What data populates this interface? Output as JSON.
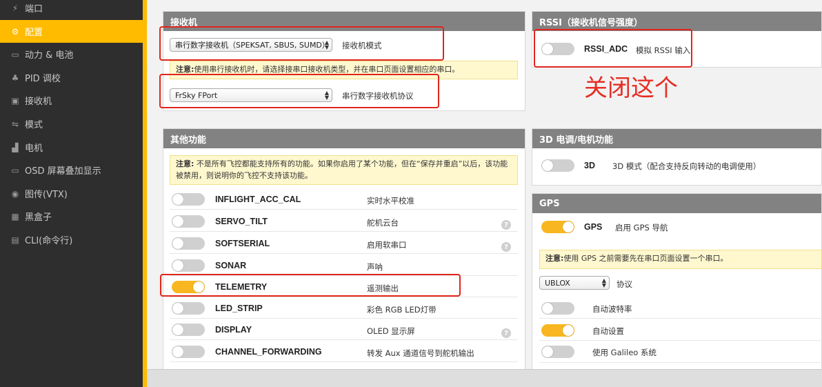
{
  "sidebar": {
    "items": [
      {
        "label": "端口",
        "icon": "plug-icon",
        "glyph": "⚡"
      },
      {
        "label": "配置",
        "icon": "gear-icon",
        "glyph": "⚙"
      },
      {
        "label": "动力 & 电池",
        "icon": "battery-icon",
        "glyph": "▭"
      },
      {
        "label": "PID 调校",
        "icon": "sitemap-icon",
        "glyph": "♣"
      },
      {
        "label": "接收机",
        "icon": "gamepad-icon",
        "glyph": "▣"
      },
      {
        "label": "模式",
        "icon": "switch-icon",
        "glyph": "⇋"
      },
      {
        "label": "电机",
        "icon": "motor-icon",
        "glyph": "▟"
      },
      {
        "label": "OSD 屏幕叠加显示",
        "icon": "osd-icon",
        "glyph": "▭"
      },
      {
        "label": "图传(VTX)",
        "icon": "broadcast-icon",
        "glyph": "◉"
      },
      {
        "label": "黑盒子",
        "icon": "blackbox-icon",
        "glyph": "▦"
      },
      {
        "label": "CLI(命令行)",
        "icon": "terminal-icon",
        "glyph": "▤"
      }
    ],
    "active_index": 1
  },
  "receiver": {
    "title": "接收机",
    "mode_select": "串行数字接收机（SPEKSAT, SBUS, SUMD）",
    "mode_label": "接收机模式",
    "note_bold": "注意:",
    "note_text": "使用串行接收机时，请选择接串口接收机类型，并在串口页面设置相应的串口。",
    "protocol_select": "FrSky FPort",
    "protocol_label": "串行数字接收机协议"
  },
  "rssi": {
    "title": "RSSI（接收机信号强度）",
    "name": "RSSI_ADC",
    "desc": "模拟 RSSI 输入",
    "enabled": false
  },
  "annotation": {
    "text": "关闭这个"
  },
  "other": {
    "title": "其他功能",
    "note_bold": "注意:",
    "note_line1": "不是所有飞控都能支持所有的功能。如果你启用了某个功能，但在“保存并重启”以后，该功能",
    "note_line2": "被禁用，则说明你的飞控不支持该功能。",
    "features": [
      {
        "name": "INFLIGHT_ACC_CAL",
        "desc": "实时水平校准",
        "enabled": false,
        "help": false
      },
      {
        "name": "SERVO_TILT",
        "desc": "舵机云台",
        "enabled": false,
        "help": true
      },
      {
        "name": "SOFTSERIAL",
        "desc": "启用软串口",
        "enabled": false,
        "help": true
      },
      {
        "name": "SONAR",
        "desc": "声呐",
        "enabled": false,
        "help": false
      },
      {
        "name": "TELEMETRY",
        "desc": "遥测输出",
        "enabled": true,
        "help": false
      },
      {
        "name": "LED_STRIP",
        "desc": "彩色 RGB LED灯带",
        "enabled": false,
        "help": false
      },
      {
        "name": "DISPLAY",
        "desc": "OLED 显示屏",
        "enabled": false,
        "help": true
      },
      {
        "name": "CHANNEL_FORWARDING",
        "desc": "转发 Aux 通道信号到舵机输出",
        "enabled": false,
        "help": false
      }
    ],
    "help_glyph": "?"
  },
  "esc3d": {
    "title": "3D 电调/电机功能",
    "name": "3D",
    "desc": "3D 模式（配合支持反向转动的电调使用）",
    "enabled": false
  },
  "gps": {
    "title": "GPS",
    "name": "GPS",
    "desc": "启用 GPS 导航",
    "enabled": true,
    "note_bold": "注意:",
    "note_text": "使用 GPS 之前需要先在串口页面设置一个串口。",
    "protocol_select": "UBLOX",
    "protocol_label": "协议",
    "options": [
      {
        "label": "自动波特率",
        "enabled": false
      },
      {
        "label": "自动设置",
        "enabled": true
      },
      {
        "label": "使用 Galileo 系统",
        "enabled": false
      }
    ]
  },
  "colors": {
    "accent": "#ffbb00",
    "annotation_red": "#e0251b",
    "sidebar_bg": "#2e2e2e",
    "panel_header": "#828282"
  }
}
